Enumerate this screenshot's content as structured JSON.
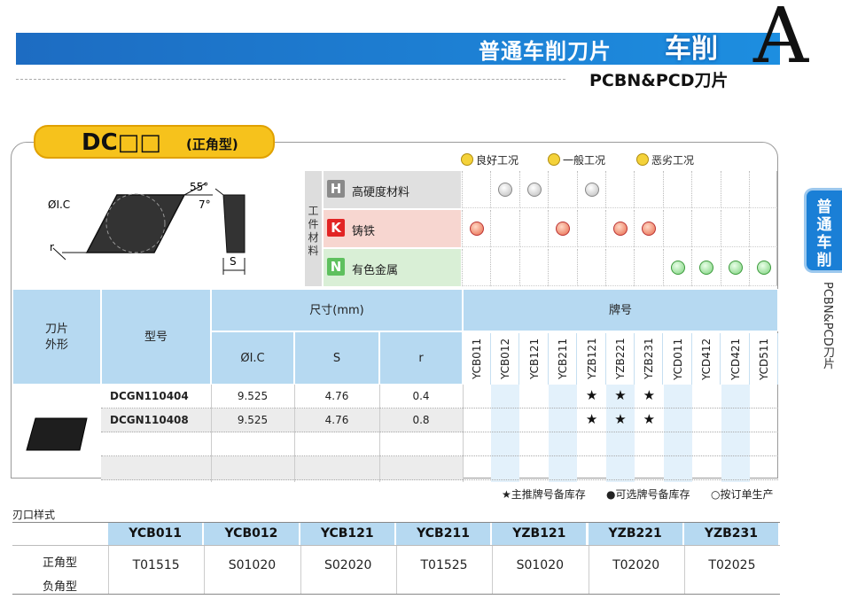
{
  "header": {
    "title": "普通车削刀片",
    "title_emph": "车削",
    "letter": "A",
    "subtitle": "PCBN&PCD刀片"
  },
  "side_tab": {
    "label": "普通车削",
    "vertical_text": "PCBN&PCD刀片"
  },
  "product": {
    "code": "DC□□",
    "shape": "(正角型)",
    "dims": {
      "ic": "ØI.C",
      "angle1": "55°",
      "angle2": "7°",
      "r": "r",
      "s": "S"
    }
  },
  "legend": {
    "good": "良好工况",
    "normal": "一般工况",
    "bad": "恶劣工况"
  },
  "materials": {
    "label": "工件材料",
    "rows": [
      {
        "badge": "H",
        "color": "#8a8a8a",
        "bg": "#e0e0e0",
        "name": "高硬度材料",
        "marks": [
          "",
          "gray",
          "gray",
          "",
          "gray",
          "",
          "",
          "",
          "",
          "",
          ""
        ]
      },
      {
        "badge": "K",
        "color": "#e22424",
        "bg": "#f7d6d0",
        "name": "铸铁",
        "marks": [
          "red",
          "",
          "",
          "red",
          "",
          "red",
          "red",
          "",
          "",
          "",
          ""
        ]
      },
      {
        "badge": "N",
        "color": "#5ec05e",
        "bg": "#d9efd6",
        "name": "有色金属",
        "marks": [
          "",
          "",
          "",
          "",
          "",
          "",
          "",
          "green",
          "green",
          "green",
          "green"
        ]
      }
    ]
  },
  "table": {
    "col_shape": "刀片外形",
    "col_model": "型号",
    "col_size": "尺寸(mm)",
    "col_ic": "ØI.C",
    "col_s": "S",
    "col_r": "r",
    "col_grade": "牌号",
    "grades": [
      "YCB011",
      "YCB012",
      "YCB121",
      "YCB211",
      "YZB121",
      "YZB221",
      "YZB231",
      "YCD011",
      "YCD412",
      "YCD421",
      "YCD511"
    ],
    "rows": [
      {
        "model": "DCGN110404",
        "ic": "9.525",
        "s": "4.76",
        "r": "0.4",
        "stars": [
          "",
          "",
          "",
          "",
          "★",
          "★",
          "★",
          "",
          "",
          "",
          ""
        ]
      },
      {
        "model": "DCGN110408",
        "ic": "9.525",
        "s": "4.76",
        "r": "0.8",
        "stars": [
          "",
          "",
          "",
          "",
          "★",
          "★",
          "★",
          "",
          "",
          "",
          ""
        ]
      }
    ]
  },
  "notes": {
    "n1": "★主推牌号备库存",
    "n2": "●可选牌号备库存",
    "n3": "○按订单生产"
  },
  "edge": {
    "title": "刃口样式",
    "headers": [
      "YCB011",
      "YCB012",
      "YCB121",
      "YCB211",
      "YZB121",
      "YZB221",
      "YZB231"
    ],
    "values": [
      "T01515",
      "S01020",
      "S02020",
      "T01525",
      "S01020",
      "T02020",
      "T02025"
    ],
    "row1": "正角型",
    "row2": "负角型"
  }
}
